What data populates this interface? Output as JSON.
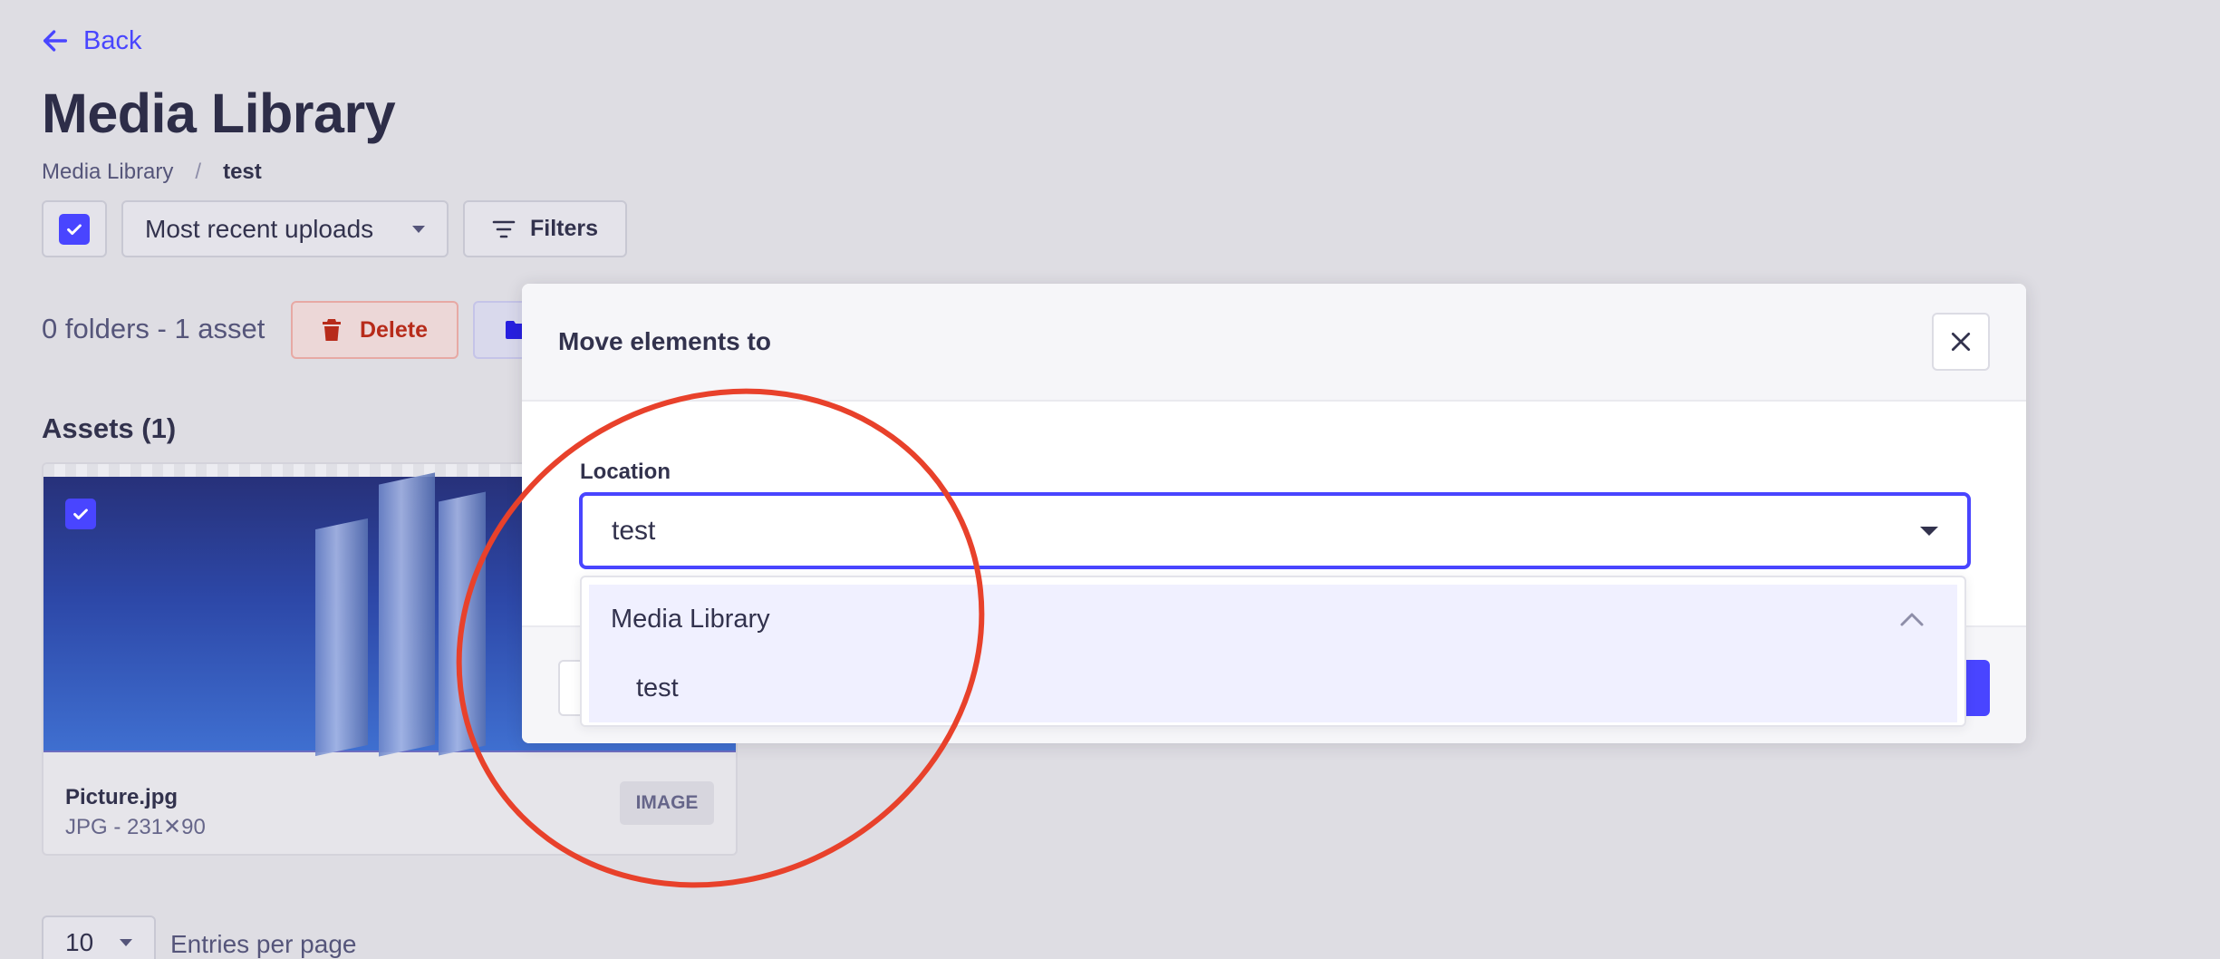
{
  "header": {
    "back_label": "Back",
    "title": "Media Library",
    "breadcrumb": [
      "Media Library",
      "/",
      "test"
    ]
  },
  "toolbar": {
    "sort_value": "Most recent uploads",
    "filters_label": "Filters",
    "count_text": "0 folders - 1 asset",
    "delete_label": "Delete"
  },
  "assets": {
    "heading": "Assets (1)",
    "items": [
      {
        "name": "Picture.jpg",
        "meta": "JPG - 231✕90",
        "badge": "IMAGE",
        "selected": true
      }
    ]
  },
  "pagination": {
    "per_page_value": "10",
    "per_page_label": "Entries per page"
  },
  "modal": {
    "title": "Move elements to",
    "location_label": "Location",
    "location_value": "test",
    "options": [
      {
        "label": "Media Library",
        "expanded": true
      },
      {
        "label": "test"
      }
    ]
  },
  "colors": {
    "primary": "#4945ff",
    "danger": "#b72b1a",
    "annotation": "#e8412b",
    "background": "#dedde3"
  },
  "icons": [
    "arrow-left-icon",
    "check-icon",
    "chevron-down-icon",
    "filter-icon",
    "trash-icon",
    "folder-icon",
    "close-icon",
    "chevron-up-icon"
  ]
}
